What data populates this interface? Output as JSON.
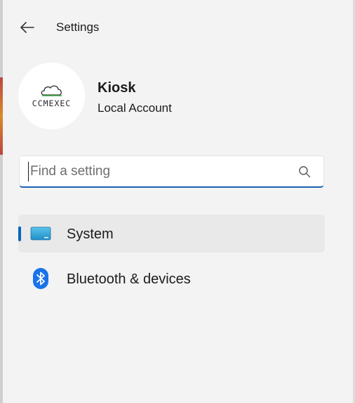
{
  "header": {
    "back_icon": "arrow-left-icon",
    "title": "Settings"
  },
  "account": {
    "avatar_logo_text": "CCMEXEC",
    "name": "Kiosk",
    "type": "Local Account"
  },
  "search": {
    "value": "",
    "placeholder": "Find a setting",
    "icon": "search-icon"
  },
  "nav": {
    "items": [
      {
        "label": "System",
        "icon": "monitor-icon",
        "selected": true
      },
      {
        "label": "Bluetooth & devices",
        "icon": "bluetooth-icon",
        "selected": false
      }
    ]
  },
  "colors": {
    "accent": "#0067c0",
    "background": "#f3f3f3",
    "selected_item": "#e9e9e9",
    "bluetooth": "#1a73e8",
    "logo_green": "#3cae3c"
  }
}
